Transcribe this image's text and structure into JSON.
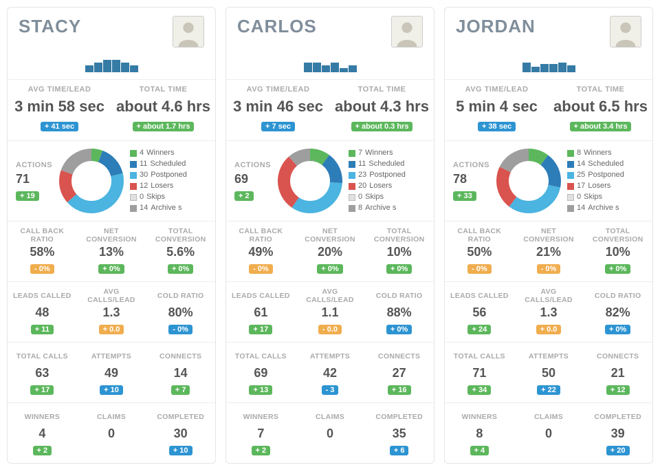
{
  "labels": {
    "avg_time_lead": "AVG TIME/LEAD",
    "total_time": "TOTAL TIME",
    "actions": "ACTIONS",
    "call_back_ratio": "CALL BACK RATIO",
    "net_conversion": "NET CONVERSION",
    "total_conversion": "TOTAL CONVERSION",
    "leads_called": "LEADS CALLED",
    "avg_calls_lead": "AVG CALLS/LEAD",
    "cold_ratio": "COLD RATIO",
    "total_calls": "TOTAL CALLS",
    "attempts": "ATTEMPTS",
    "connects": "CONNECTS",
    "winners_label": "WINNERS",
    "claims_label": "CLAIMS",
    "completed_label": "COMPLETED"
  },
  "legend_keys": {
    "winners": "Winners",
    "scheduled": "Scheduled",
    "postponed": "Postponed",
    "losers": "Losers",
    "skips": "Skips",
    "archives": "Archive s"
  },
  "colors": {
    "winners": "#5cb75c",
    "scheduled": "#2d7db8",
    "postponed": "#4bb4e0",
    "losers": "#d9534f",
    "skips": "#e0e0e0",
    "archives": "#9e9e9e"
  },
  "people": [
    {
      "name": "STACY",
      "spark": [
        10,
        14,
        18,
        18,
        14,
        10
      ],
      "avg_time": "3 min 58 sec",
      "avg_time_delta": "+ 41 sec",
      "avg_time_color": "d-blue",
      "total_time": "about 4.6 hrs",
      "total_time_delta": "+ about 1.7 hrs",
      "total_time_color": "d-green",
      "actions": "71",
      "actions_delta": "+ 19",
      "actions_color": "d-green",
      "donut": {
        "winners": 4,
        "scheduled": 11,
        "postponed": 30,
        "losers": 12,
        "skips": 0,
        "archives": 14
      },
      "metrics": [
        {
          "key": "call_back_ratio",
          "val": "58%",
          "delta": "- 0%",
          "color": "d-orange"
        },
        {
          "key": "net_conversion",
          "val": "13%",
          "delta": "+ 0%",
          "color": "d-green"
        },
        {
          "key": "total_conversion",
          "val": "5.6%",
          "delta": "+ 0%",
          "color": "d-green"
        },
        {
          "key": "leads_called",
          "val": "48",
          "delta": "+ 11",
          "color": "d-green"
        },
        {
          "key": "avg_calls_lead",
          "val": "1.3",
          "delta": "+ 0.0",
          "color": "d-orange"
        },
        {
          "key": "cold_ratio",
          "val": "80%",
          "delta": "- 0%",
          "color": "d-blue"
        },
        {
          "key": "total_calls",
          "val": "63",
          "delta": "+ 17",
          "color": "d-green"
        },
        {
          "key": "attempts",
          "val": "49",
          "delta": "+ 10",
          "color": "d-blue"
        },
        {
          "key": "connects",
          "val": "14",
          "delta": "+ 7",
          "color": "d-green"
        },
        {
          "key": "winners_label",
          "val": "4",
          "delta": "+ 2",
          "color": "d-green"
        },
        {
          "key": "claims_label",
          "val": "0",
          "delta": "",
          "color": ""
        },
        {
          "key": "completed_label",
          "val": "30",
          "delta": "+ 10",
          "color": "d-blue"
        }
      ]
    },
    {
      "name": "CARLOS",
      "spark": [
        14,
        14,
        10,
        14,
        6,
        10
      ],
      "avg_time": "3 min 46 sec",
      "avg_time_delta": "+ 7 sec",
      "avg_time_color": "d-blue",
      "total_time": "about 4.3 hrs",
      "total_time_delta": "+ about 0.3 hrs",
      "total_time_color": "d-green",
      "actions": "69",
      "actions_delta": "+ 2",
      "actions_color": "d-green",
      "donut": {
        "winners": 7,
        "scheduled": 11,
        "postponed": 23,
        "losers": 20,
        "skips": 0,
        "archives": 8
      },
      "metrics": [
        {
          "key": "call_back_ratio",
          "val": "49%",
          "delta": "- 0%",
          "color": "d-orange"
        },
        {
          "key": "net_conversion",
          "val": "20%",
          "delta": "+ 0%",
          "color": "d-green"
        },
        {
          "key": "total_conversion",
          "val": "10%",
          "delta": "+ 0%",
          "color": "d-green"
        },
        {
          "key": "leads_called",
          "val": "61",
          "delta": "+ 17",
          "color": "d-green"
        },
        {
          "key": "avg_calls_lead",
          "val": "1.1",
          "delta": "- 0.0",
          "color": "d-orange"
        },
        {
          "key": "cold_ratio",
          "val": "88%",
          "delta": "+ 0%",
          "color": "d-blue"
        },
        {
          "key": "total_calls",
          "val": "69",
          "delta": "+ 13",
          "color": "d-green"
        },
        {
          "key": "attempts",
          "val": "42",
          "delta": "- 3",
          "color": "d-blue"
        },
        {
          "key": "connects",
          "val": "27",
          "delta": "+ 16",
          "color": "d-green"
        },
        {
          "key": "winners_label",
          "val": "7",
          "delta": "+ 2",
          "color": "d-green"
        },
        {
          "key": "claims_label",
          "val": "0",
          "delta": "",
          "color": ""
        },
        {
          "key": "completed_label",
          "val": "35",
          "delta": "+ 6",
          "color": "d-blue"
        }
      ]
    },
    {
      "name": "JORDAN",
      "spark": [
        14,
        8,
        12,
        12,
        14,
        10
      ],
      "avg_time": "5 min 4 sec",
      "avg_time_delta": "+ 38 sec",
      "avg_time_color": "d-blue",
      "total_time": "about 6.5 hrs",
      "total_time_delta": "+ about 3.4 hrs",
      "total_time_color": "d-green",
      "actions": "78",
      "actions_delta": "+ 33",
      "actions_color": "d-green",
      "donut": {
        "winners": 8,
        "scheduled": 14,
        "postponed": 25,
        "losers": 17,
        "skips": 0,
        "archives": 14
      },
      "metrics": [
        {
          "key": "call_back_ratio",
          "val": "50%",
          "delta": "- 0%",
          "color": "d-orange"
        },
        {
          "key": "net_conversion",
          "val": "21%",
          "delta": "- 0%",
          "color": "d-orange"
        },
        {
          "key": "total_conversion",
          "val": "10%",
          "delta": "+ 0%",
          "color": "d-green"
        },
        {
          "key": "leads_called",
          "val": "56",
          "delta": "+ 24",
          "color": "d-green"
        },
        {
          "key": "avg_calls_lead",
          "val": "1.3",
          "delta": "+ 0.0",
          "color": "d-orange"
        },
        {
          "key": "cold_ratio",
          "val": "82%",
          "delta": "+ 0%",
          "color": "d-blue"
        },
        {
          "key": "total_calls",
          "val": "71",
          "delta": "+ 34",
          "color": "d-green"
        },
        {
          "key": "attempts",
          "val": "50",
          "delta": "+ 22",
          "color": "d-blue"
        },
        {
          "key": "connects",
          "val": "21",
          "delta": "+ 12",
          "color": "d-green"
        },
        {
          "key": "winners_label",
          "val": "8",
          "delta": "+ 4",
          "color": "d-green"
        },
        {
          "key": "claims_label",
          "val": "0",
          "delta": "",
          "color": ""
        },
        {
          "key": "completed_label",
          "val": "39",
          "delta": "+ 20",
          "color": "d-blue"
        }
      ]
    }
  ],
  "chart_data": [
    {
      "type": "pie",
      "title": "Stacy – Actions breakdown",
      "categories": [
        "Winners",
        "Scheduled",
        "Postponed",
        "Losers",
        "Skips",
        "Archive s"
      ],
      "values": [
        4,
        11,
        30,
        12,
        0,
        14
      ]
    },
    {
      "type": "pie",
      "title": "Carlos – Actions breakdown",
      "categories": [
        "Winners",
        "Scheduled",
        "Postponed",
        "Losers",
        "Skips",
        "Archive s"
      ],
      "values": [
        7,
        11,
        23,
        20,
        0,
        8
      ]
    },
    {
      "type": "pie",
      "title": "Jordan – Actions breakdown",
      "categories": [
        "Winners",
        "Scheduled",
        "Postponed",
        "Losers",
        "Skips",
        "Archive s"
      ],
      "values": [
        8,
        14,
        25,
        17,
        0,
        14
      ]
    },
    {
      "type": "bar",
      "title": "Stacy activity sparkline",
      "categories": [
        "1",
        "2",
        "3",
        "4",
        "5",
        "6"
      ],
      "values": [
        10,
        14,
        18,
        18,
        14,
        10
      ]
    },
    {
      "type": "bar",
      "title": "Carlos activity sparkline",
      "categories": [
        "1",
        "2",
        "3",
        "4",
        "5",
        "6"
      ],
      "values": [
        14,
        14,
        10,
        14,
        6,
        10
      ]
    },
    {
      "type": "bar",
      "title": "Jordan activity sparkline",
      "categories": [
        "1",
        "2",
        "3",
        "4",
        "5",
        "6"
      ],
      "values": [
        14,
        8,
        12,
        12,
        14,
        10
      ]
    }
  ]
}
